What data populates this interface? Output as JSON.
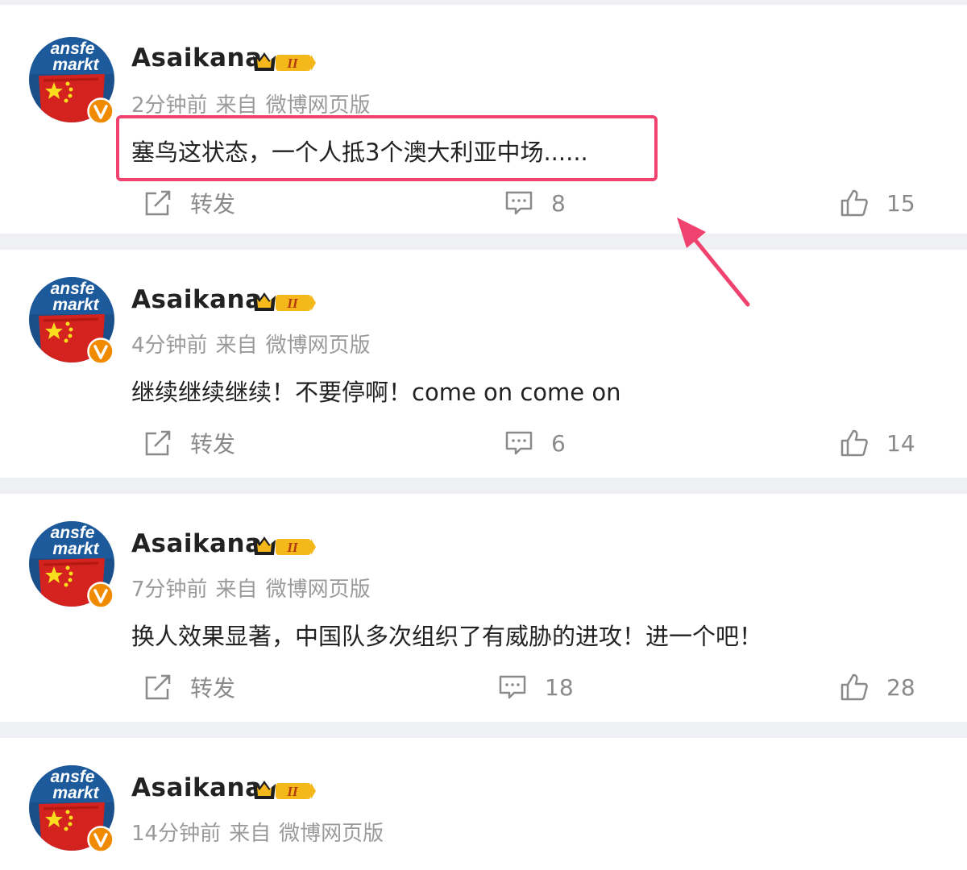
{
  "avatar_text": [
    "ansfe",
    "markt"
  ],
  "vip_level": "II",
  "actions": {
    "repost_label": "转发"
  },
  "posts": [
    {
      "username": "Asaikana",
      "time": "2分钟前",
      "from_label": "来自",
      "source": "微博网页版",
      "content": "塞鸟这状态，一个人抵3个澳大利亚中场......",
      "comments": "8",
      "likes": "15"
    },
    {
      "username": "Asaikana",
      "time": "4分钟前",
      "from_label": "来自",
      "source": "微博网页版",
      "content": "继续继续继续！不要停啊！come on come on",
      "comments": "6",
      "likes": "14"
    },
    {
      "username": "Asaikana",
      "time": "7分钟前",
      "from_label": "来自",
      "source": "微博网页版",
      "content": "换人效果显著，中国队多次组织了有威胁的进攻！进一个吧！",
      "comments": "18",
      "likes": "28"
    },
    {
      "username": "Asaikana",
      "time": "14分钟前",
      "from_label": "来自",
      "source": "微博网页版",
      "content": "",
      "comments": "",
      "likes": ""
    }
  ],
  "colors": {
    "highlight": "#f0426f",
    "badge_orange": "#f08a00",
    "vip_gold": "#f5b81b",
    "text_muted": "#9a9a9a"
  },
  "icons": [
    "repost-icon",
    "comment-icon",
    "like-icon",
    "crown-icon",
    "verified-v-icon"
  ]
}
